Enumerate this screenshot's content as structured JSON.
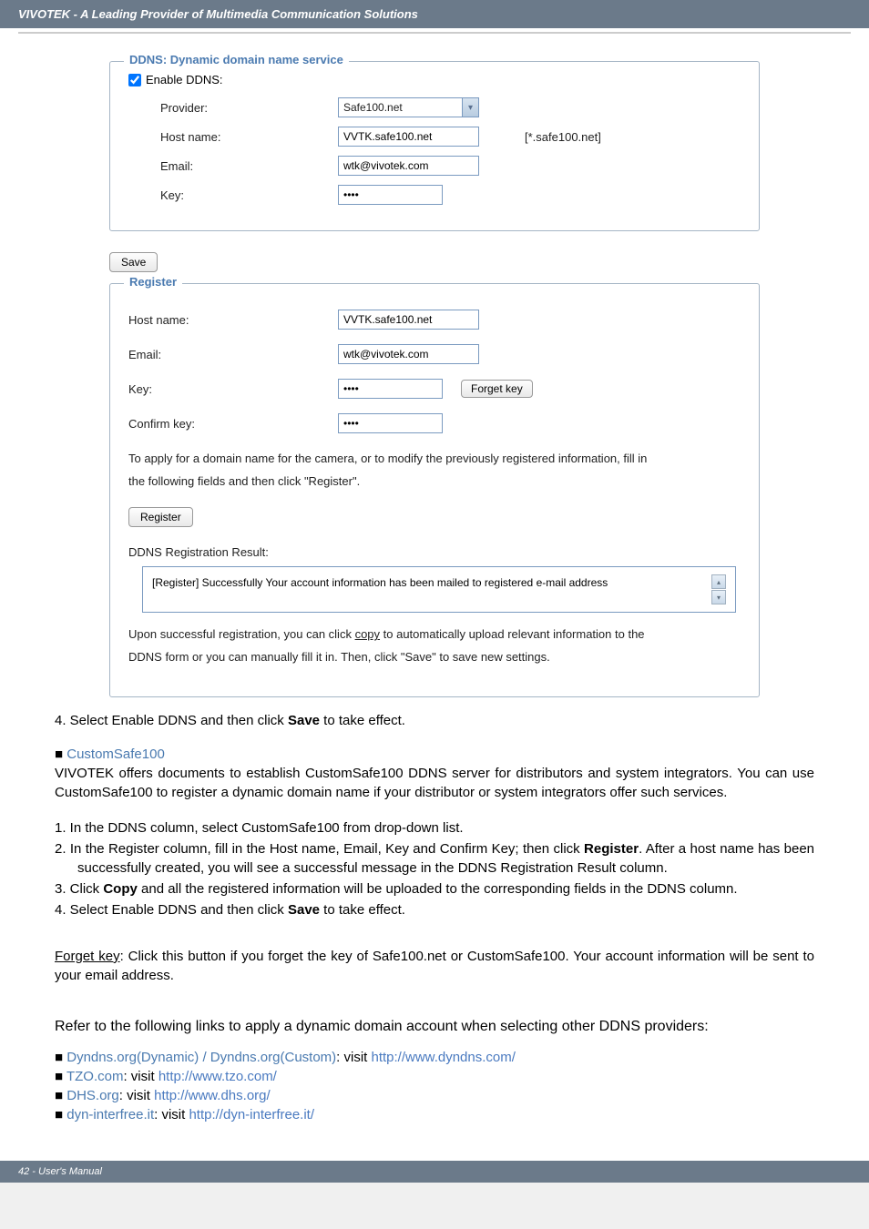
{
  "header": {
    "title": "VIVOTEK - A Leading Provider of Multimedia Communication Solutions"
  },
  "ddns_panel": {
    "legend": "DDNS: Dynamic domain name service",
    "enable_label": "Enable DDNS:",
    "provider_label": "Provider:",
    "provider_value": "Safe100.net",
    "hostname_label": "Host name:",
    "hostname_value": "VVTK.safe100.net",
    "hostname_suffix": "[*.safe100.net]",
    "email_label": "Email:",
    "email_value": "wtk@vivotek.com",
    "key_label": "Key:",
    "key_value": "••••"
  },
  "save_btn": "Save",
  "register_panel": {
    "legend": "Register",
    "hostname_label": "Host name:",
    "hostname_value": "VVTK.safe100.net",
    "email_label": "Email:",
    "email_value": "wtk@vivotek.com",
    "key_label": "Key:",
    "key_value": "••••",
    "forget_btn": "Forget key",
    "confirm_key_label": "Confirm key:",
    "confirm_key_value": "••••",
    "instruction_1": "To apply for a domain name for the camera, or to modify the previously registered information, fill in",
    "instruction_2": "the following fields and then click \"Register\".",
    "register_btn": "Register",
    "result_label": "DDNS Registration Result:",
    "result_text": "[Register] Successfully  Your account information has been mailed to registered e-mail address",
    "post_text_1": "Upon successful registration, you can click  copy to automatically upload relevant information to the",
    "post_text_2": "DDNS form or you can manually fill it in. Then, click \"Save\" to save new settings."
  },
  "body": {
    "step4_top": "4. Select Enable DDNS and then click ",
    "save_bold": "Save",
    "step4_end": " to take effect.",
    "customsafe_heading": "CustomSafe100",
    "customsafe_para": "VIVOTEK offers documents to establish CustomSafe100 DDNS server for distributors and system integrators. You can use CustomSafe100 to register a dynamic domain name if your distributor or system integrators offer such services.",
    "cs_step1": "1. In the DDNS column, select CustomSafe100 from drop-down list.",
    "cs_step2_a": "2. In the Register column, fill in the Host name, Email, Key and Confirm Key; then click ",
    "cs_step2_bold": "Register",
    "cs_step2_b": ". After a host name has been successfully created, you will see a successful message in the DDNS Registration Result column.",
    "cs_step3_a": "3. Click ",
    "cs_step3_bold": "Copy",
    "cs_step3_b": " and all the registered information will be uploaded to the corresponding fields in the DDNS column.",
    "cs_step4_a": "4. Select Enable DDNS and then click ",
    "cs_step4_bold": "Save",
    "cs_step4_b": " to take effect.",
    "forget_key_label": "Forget key",
    "forget_key_text": ": Click this button if you forget the key of Safe100.net or CustomSafe100. Your account information will be sent to your email address.",
    "refer_text": "Refer to the following links to apply a dynamic domain account when selecting other DDNS providers:",
    "link1_name": "Dyndns.org(Dynamic) / Dyndns.org(Custom)",
    "link1_visit": ": visit ",
    "link1_url": "http://www.dyndns.com/",
    "link2_name": "TZO.com",
    "link2_visit": ": visit ",
    "link2_url": "http://www.tzo.com/",
    "link3_name": "DHS.org",
    "link3_visit": ": visit ",
    "link3_url": "http://www.dhs.org/",
    "link4_name": "dyn-interfree.it",
    "link4_visit": ": visit ",
    "link4_url": "http://dyn-interfree.it/"
  },
  "footer": {
    "text": "42 - User's Manual"
  }
}
